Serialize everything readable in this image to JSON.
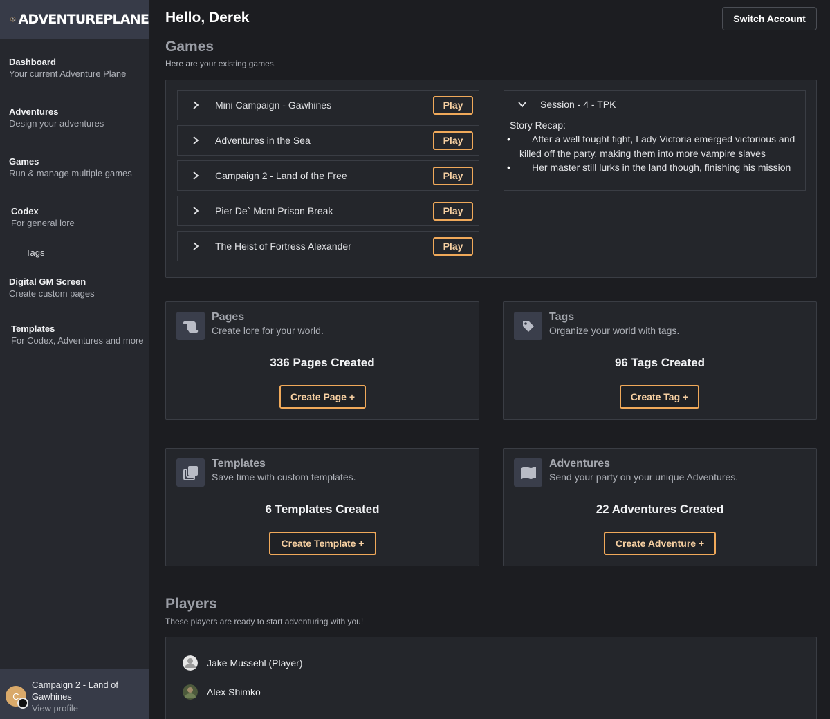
{
  "brand": {
    "name": "ADVENTUREPLANE"
  },
  "sidebar": {
    "items": [
      {
        "title": "Dashboard",
        "subtitle": "Your current Adventure Plane"
      },
      {
        "title": "Adventures",
        "subtitle": "Design your adventures"
      },
      {
        "title": "Games",
        "subtitle": "Run & manage multiple games"
      },
      {
        "title": "Codex",
        "subtitle": "For general lore"
      },
      {
        "title": "Tags"
      },
      {
        "title": "Digital GM Screen",
        "subtitle": "Create custom pages"
      },
      {
        "title": "Templates",
        "subtitle": "For Codex, Adventures and more"
      }
    ],
    "footer": {
      "avatar_initial": "C",
      "game": "Campaign 2 - Land of Gawhines",
      "link": "View profile"
    }
  },
  "header": {
    "greeting": "Hello, Derek",
    "switch_account": "Switch Account"
  },
  "games": {
    "title": "Games",
    "subtitle": "Here are your existing games.",
    "play_label": "Play",
    "list": [
      {
        "name": "Mini Campaign - Gawhines"
      },
      {
        "name": "Adventures in the Sea"
      },
      {
        "name": "Campaign 2 - Land of the Free"
      },
      {
        "name": "Pier De` Mont Prison Break"
      },
      {
        "name": "The Heist of Fortress Alexander"
      }
    ],
    "session": {
      "title": "Session - 4 - TPK",
      "recap_label": "Story Recap:",
      "bullets": [
        "After a well fought fight, Lady Victoria emerged victorious and killed off the party, making them into more vampire slaves",
        "Her master still lurks in the land though, finishing his mission"
      ]
    }
  },
  "cards": [
    {
      "icon": "scroll-icon",
      "title": "Pages",
      "subtitle": "Create lore for your world.",
      "count": "336 Pages Created",
      "button": "Create Page +"
    },
    {
      "icon": "tag-icon",
      "title": "Tags",
      "subtitle": "Organize your world with tags.",
      "count": "96 Tags Created",
      "button": "Create Tag +"
    },
    {
      "icon": "copy-icon",
      "title": "Templates",
      "subtitle": "Save time with custom templates.",
      "count": "6 Templates Created",
      "button": "Create Template +"
    },
    {
      "icon": "map-icon",
      "title": "Adventures",
      "subtitle": "Send your party on your unique Adventures.",
      "count": "22 Adventures Created",
      "button": "Create Adventure +"
    }
  ],
  "players": {
    "title": "Players",
    "subtitle": "These players are ready to start adventuring with you!",
    "list": [
      {
        "name": "Jake Mussehl (Player)"
      },
      {
        "name": "Alex Shimko"
      }
    ]
  },
  "colors": {
    "accent": "#f0a95a",
    "background": "#1c1d21",
    "sidebar": "#26282e",
    "panel": "#24262b"
  }
}
